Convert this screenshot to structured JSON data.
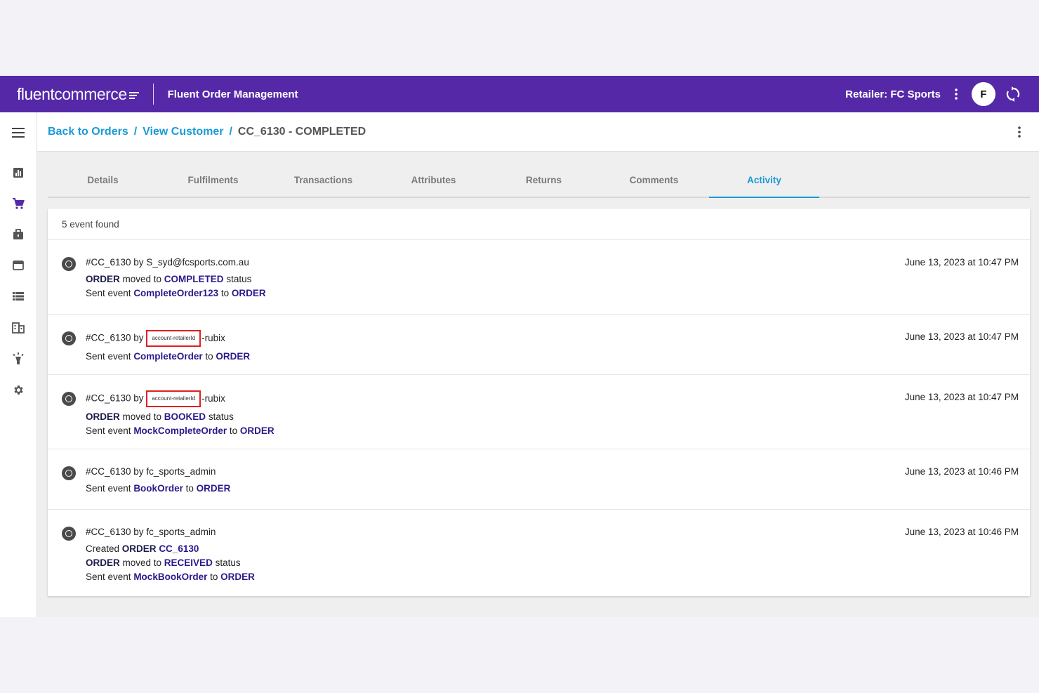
{
  "header": {
    "logo_part1": "fluent",
    "logo_part2": "commerce",
    "app_name": "Fluent Order Management",
    "retailer": "Retailer: FC Sports",
    "avatar_letter": "F"
  },
  "breadcrumb": {
    "back_to_orders": "Back to Orders",
    "view_customer": "View Customer",
    "current": "CC_6130 - COMPLETED",
    "separator": "/"
  },
  "tabs": [
    "Details",
    "Fulfilments",
    "Transactions",
    "Attributes",
    "Returns",
    "Comments",
    "Activity"
  ],
  "active_tab": "Activity",
  "activity": {
    "count_text": "5 event found",
    "events": [
      {
        "header_prefix": "#CC_6130 by ",
        "header_user": "S_syd@fcsports.com.au",
        "time": "June 13, 2023 at 10:47 PM"
      },
      {
        "header_prefix": "#CC_6130 by",
        "redacted_label": "account-retailerId",
        "header_suffix": "-rubix",
        "time": "June 13, 2023 at 10:47 PM"
      },
      {
        "header_prefix": "#CC_6130 by",
        "redacted_label": "account-retailerId",
        "header_suffix": "-rubix",
        "time": "June 13, 2023 at 10:47 PM"
      },
      {
        "header_prefix": "#CC_6130 by ",
        "header_user": "fc_sports_admin",
        "time": "June 13, 2023 at 10:46 PM"
      },
      {
        "header_prefix": "#CC_6130 by ",
        "header_user": "fc_sports_admin",
        "time": "June 13, 2023 at 10:46 PM"
      }
    ],
    "words": {
      "order": "ORDER",
      "moved_to": " moved to ",
      "status": " status",
      "sent_event": "Sent event ",
      "to": " to ",
      "created": "Created ",
      "completed": "COMPLETED",
      "booked": "BOOKED",
      "received": "RECEIVED",
      "complete_order_123": "CompleteOrder123",
      "complete_order": "CompleteOrder",
      "mock_complete_order": "MockCompleteOrder",
      "book_order": "BookOrder",
      "mock_book_order": "MockBookOrder",
      "order_ref": "CC_6130"
    }
  },
  "colors": {
    "header_bg": "#5528a8",
    "link": "#1a9ad6",
    "event_highlight": "#2a1a8a",
    "redaction_border": "#e02020"
  },
  "icons": [
    "menu-icon",
    "dashboard-icon",
    "cart-icon",
    "briefcase-icon",
    "browser-icon",
    "list-icon",
    "building-icon",
    "lightbulb-icon",
    "settings-icon",
    "kebab-icon",
    "refresh-icon"
  ]
}
